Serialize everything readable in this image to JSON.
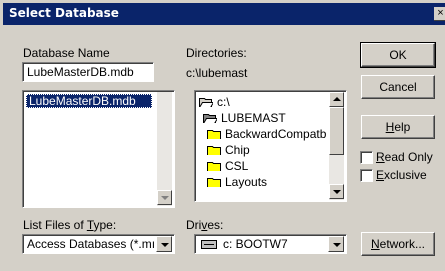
{
  "window": {
    "title": "Select Database",
    "close_glyph": "×"
  },
  "database_name": {
    "label": "Database Name",
    "value": "LubeMasterDB.mdb",
    "list_items": [
      "LubeMasterDB.mdb"
    ]
  },
  "directories": {
    "label": "Directories:",
    "current_path": "c:\\lubemast",
    "tree": [
      {
        "label": "c:\\",
        "icon": "open-folder-icon"
      },
      {
        "label": "LUBEMAST",
        "icon": "open-folder-icon"
      },
      {
        "label": "BackwardCompatb",
        "icon": "folder-icon"
      },
      {
        "label": "Chip",
        "icon": "folder-icon"
      },
      {
        "label": "CSL",
        "icon": "folder-icon"
      },
      {
        "label": "Layouts",
        "icon": "folder-icon"
      }
    ]
  },
  "file_type": {
    "label": "List Files of Type:",
    "value": "Access Databases (*.mı"
  },
  "drives": {
    "label": "Drives:",
    "value": "c: BOOTW7",
    "icon": "drive-icon"
  },
  "buttons": {
    "ok": "OK",
    "cancel": "Cancel",
    "help": "Help",
    "network": "Network..."
  },
  "options": {
    "read_only": {
      "label": "Read Only",
      "checked": false
    },
    "exclusive": {
      "label": "Exclusive",
      "checked": false
    }
  },
  "colors": {
    "titlebar": "#0a246a",
    "selection": "#0a246a",
    "face": "#d4d0c8"
  }
}
